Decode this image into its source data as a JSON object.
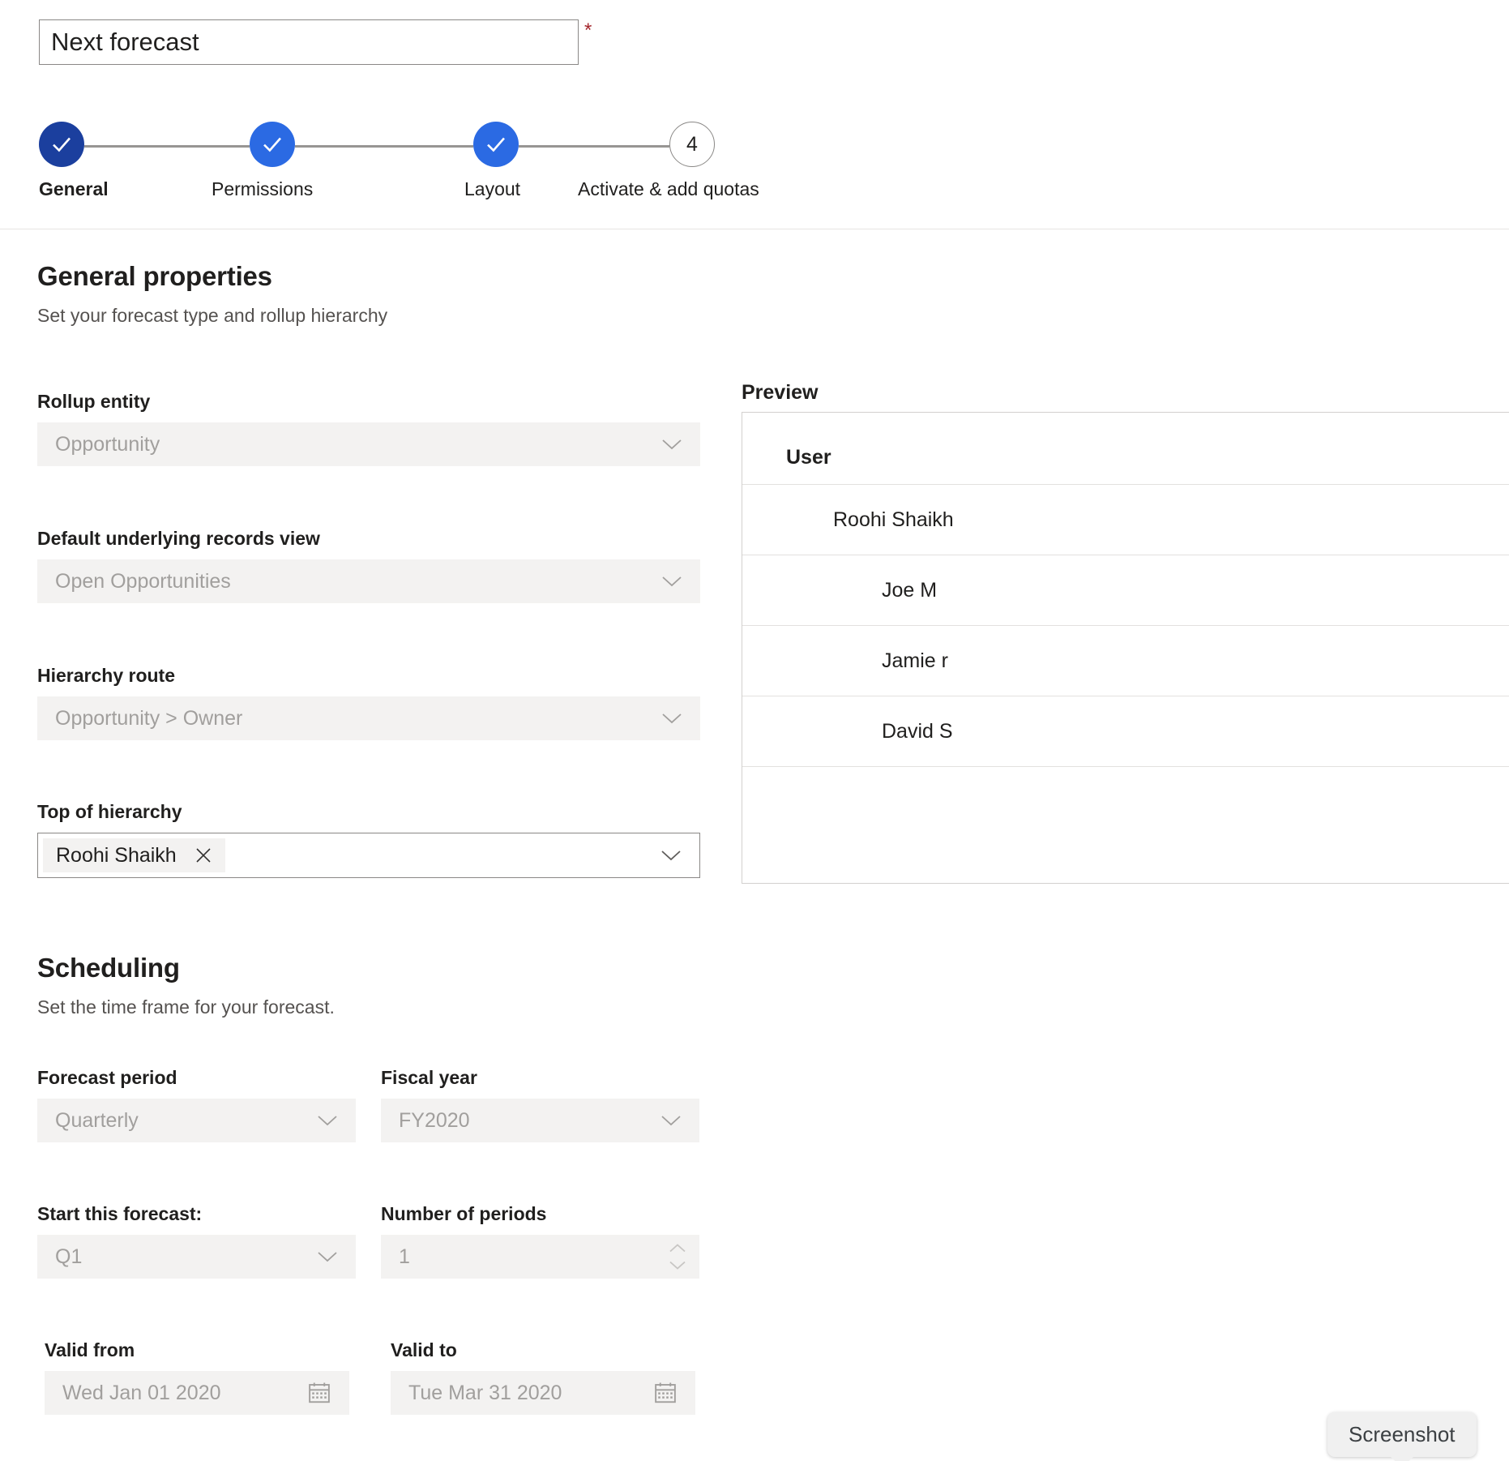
{
  "forecast_name": {
    "value": "Next forecast",
    "required_marker": "*"
  },
  "stepper": {
    "steps": [
      {
        "label": "General",
        "state": "done-first",
        "glyph": "check"
      },
      {
        "label": "Permissions",
        "state": "done",
        "glyph": "check"
      },
      {
        "label": "Layout",
        "state": "done",
        "glyph": "check"
      },
      {
        "label": "Activate & add quotas",
        "state": "pending",
        "glyph": "4"
      }
    ]
  },
  "general": {
    "title": "General properties",
    "subtitle": "Set your forecast type and rollup hierarchy",
    "fields": {
      "rollup_entity": {
        "label": "Rollup entity",
        "value": "Opportunity"
      },
      "records_view": {
        "label": "Default underlying records view",
        "value": "Open Opportunities"
      },
      "hierarchy_route": {
        "label": "Hierarchy route",
        "value": "Opportunity > Owner"
      },
      "top_of_hierarchy": {
        "label": "Top of hierarchy",
        "token": "Roohi Shaikh",
        "remove_label": "✕"
      }
    }
  },
  "preview": {
    "label": "Preview",
    "column_header": "User",
    "rows": [
      {
        "name": "Roohi Shaikh",
        "level": 1
      },
      {
        "name": "Joe M",
        "level": 2
      },
      {
        "name": "Jamie r",
        "level": 2
      },
      {
        "name": "David S",
        "level": 2
      }
    ]
  },
  "scheduling": {
    "title": "Scheduling",
    "subtitle": "Set the time frame for your forecast.",
    "fields": {
      "forecast_period": {
        "label": "Forecast period",
        "value": "Quarterly"
      },
      "fiscal_year": {
        "label": "Fiscal year",
        "value": "FY2020"
      },
      "start_forecast": {
        "label": "Start this forecast:",
        "value": "Q1"
      },
      "number_of_periods": {
        "label": "Number of periods",
        "value": "1"
      },
      "valid_from": {
        "label": "Valid from",
        "value": "Wed Jan 01 2020"
      },
      "valid_to": {
        "label": "Valid to",
        "value": "Tue Mar 31 2020"
      }
    }
  },
  "tooltip": {
    "text": "Screenshot"
  },
  "colors": {
    "step_active": "#1b3f9e",
    "step_done": "#2b6ae3",
    "required": "#a4262c",
    "field_bg": "#f3f2f1"
  }
}
